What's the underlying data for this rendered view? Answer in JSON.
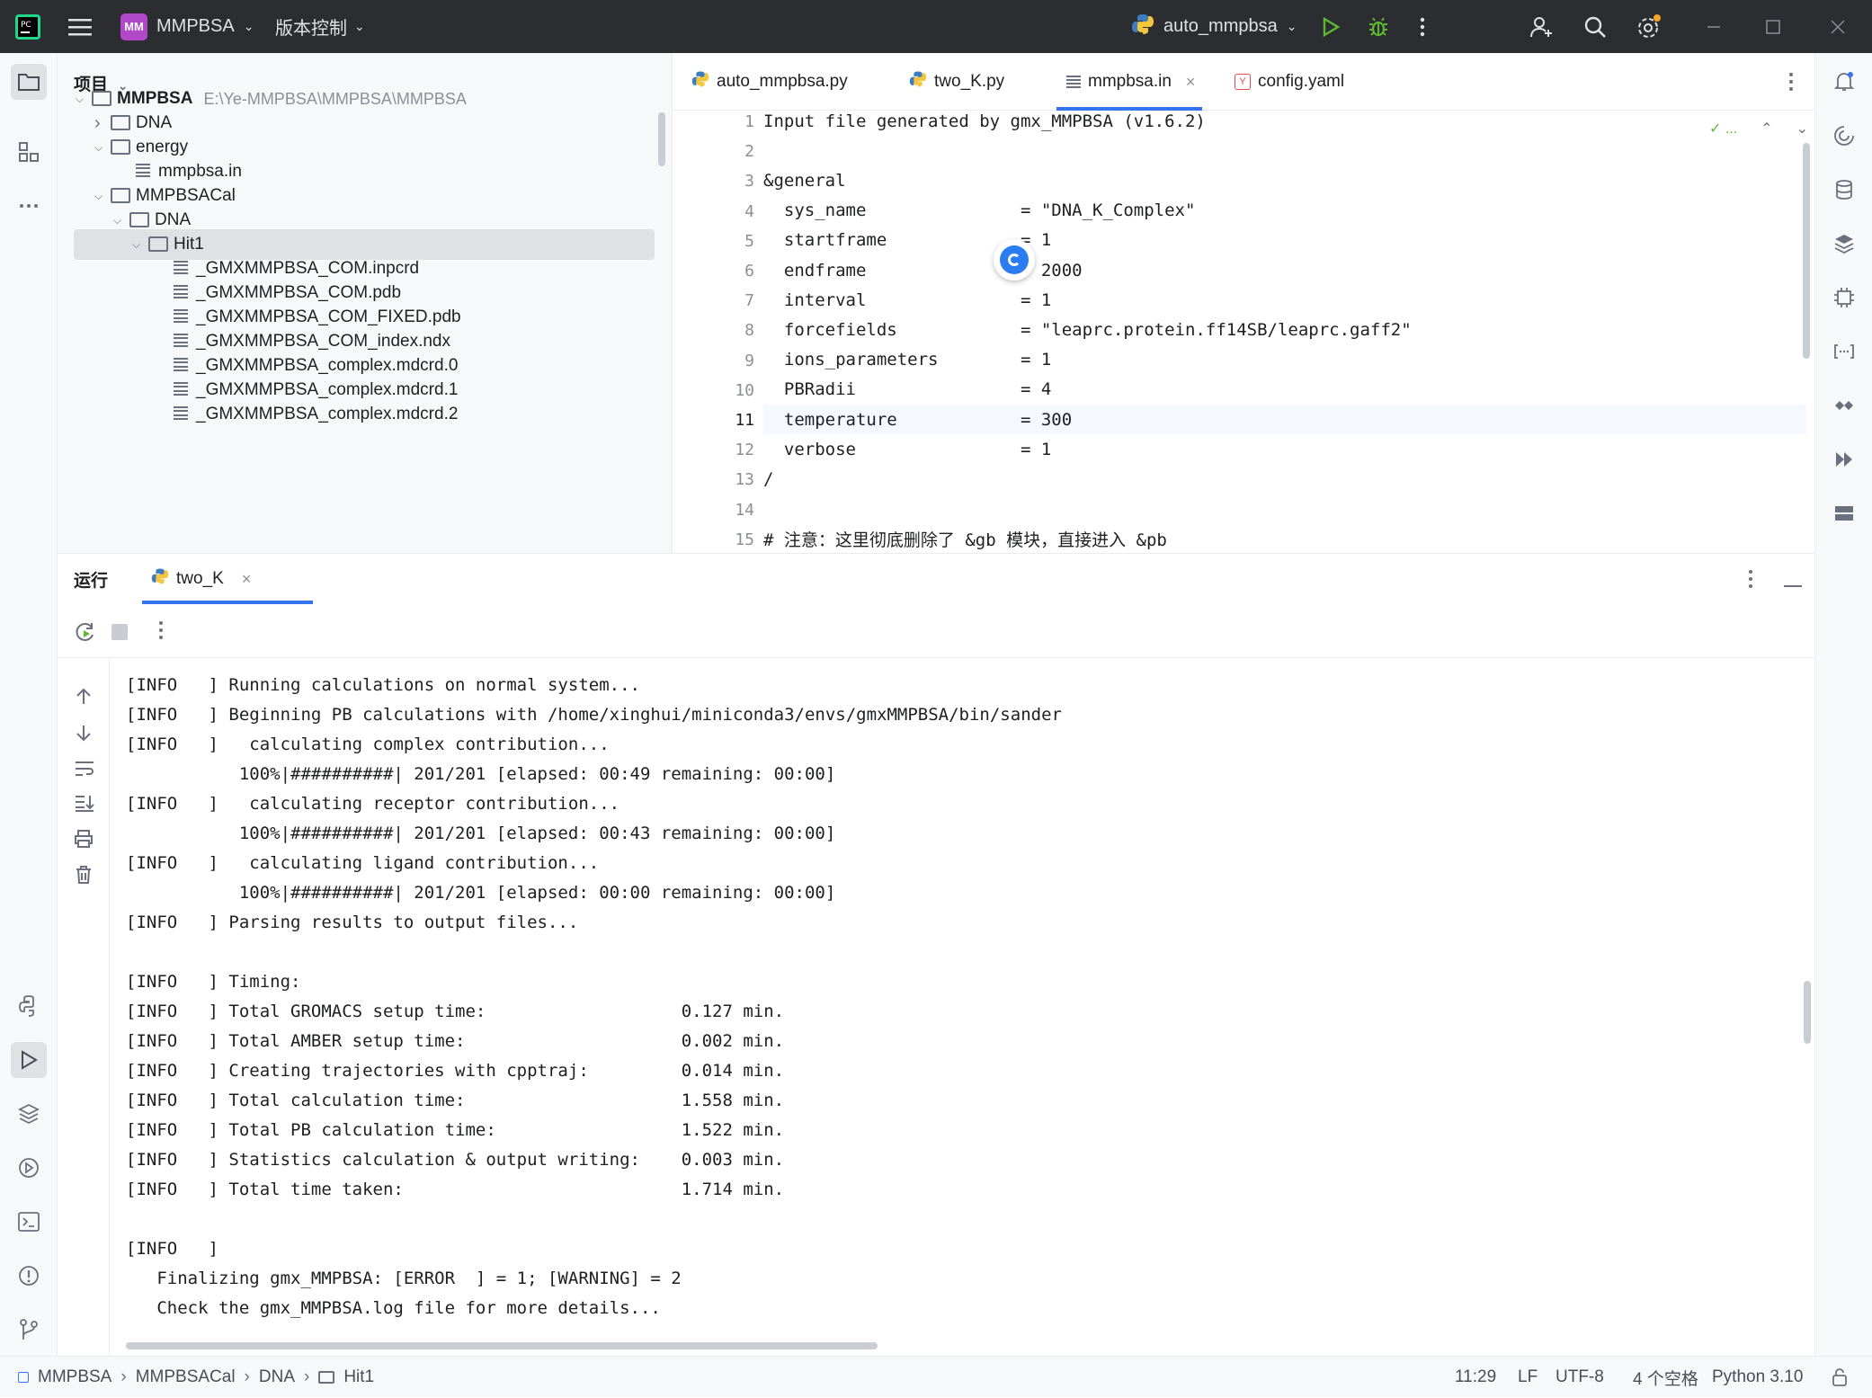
{
  "titlebar": {
    "project_badge": "MM",
    "project_name": "MMPBSA",
    "vcs_label": "版本控制",
    "run_config": "auto_mmpbsa"
  },
  "project_panel": {
    "title": "项目",
    "tree": [
      {
        "label": "MMPBSA",
        "path": "E:\\Ye-MMPBSA\\MMPBSA\\MMPBSA",
        "type": "folder",
        "depth": 0,
        "expanded": true
      },
      {
        "label": "DNA",
        "type": "folder",
        "depth": 1,
        "expanded": false
      },
      {
        "label": "energy",
        "type": "folder",
        "depth": 1,
        "expanded": true
      },
      {
        "label": "mmpbsa.in",
        "type": "file",
        "depth": 2
      },
      {
        "label": "MMPBSACal",
        "type": "folder",
        "depth": 1,
        "expanded": true
      },
      {
        "label": "DNA",
        "type": "folder",
        "depth": 2,
        "expanded": true
      },
      {
        "label": "Hit1",
        "type": "folder",
        "depth": 3,
        "expanded": true,
        "selected": true
      },
      {
        "label": "_GMXMMPBSA_COM.inpcrd",
        "type": "file",
        "depth": 4
      },
      {
        "label": "_GMXMMPBSA_COM.pdb",
        "type": "file",
        "depth": 4
      },
      {
        "label": "_GMXMMPBSA_COM_FIXED.pdb",
        "type": "file",
        "depth": 4
      },
      {
        "label": "_GMXMMPBSA_COM_index.ndx",
        "type": "file",
        "depth": 4
      },
      {
        "label": "_GMXMMPBSA_complex.mdcrd.0",
        "type": "file",
        "depth": 4
      },
      {
        "label": "_GMXMMPBSA_complex.mdcrd.1",
        "type": "file",
        "depth": 4
      },
      {
        "label": "_GMXMMPBSA_complex.mdcrd.2",
        "type": "file",
        "depth": 4
      }
    ]
  },
  "editor": {
    "tabs": [
      {
        "label": "auto_mmpbsa.py",
        "icon": "python-icon"
      },
      {
        "label": "two_K.py",
        "icon": "python-icon"
      },
      {
        "label": "mmpbsa.in",
        "icon": "text-file-icon",
        "active": true
      },
      {
        "label": "config.yaml",
        "icon": "yaml-icon"
      }
    ],
    "inspection": "✓ ...",
    "current_line": 11,
    "lines": [
      {
        "n": "1",
        "text": "Input file generated by gmx_MMPBSA (v1.6.2)"
      },
      {
        "n": "2",
        "text": ""
      },
      {
        "n": "3",
        "text": "&general"
      },
      {
        "n": "4",
        "text": "  sys_name               = \"DNA_K_Complex\""
      },
      {
        "n": "5",
        "text": "  startframe             = 1"
      },
      {
        "n": "6",
        "text": "  endframe               = 2000"
      },
      {
        "n": "7",
        "text": "  interval               = 1"
      },
      {
        "n": "8",
        "text": "  forcefields            = \"leaprc.protein.ff14SB/leaprc.gaff2\""
      },
      {
        "n": "9",
        "text": "  ions_parameters        = 1"
      },
      {
        "n": "10",
        "text": "  PBRadii                = 4"
      },
      {
        "n": "11",
        "text": "  temperature            = 300"
      },
      {
        "n": "12",
        "text": "  verbose                = 1"
      },
      {
        "n": "13",
        "text": "/"
      },
      {
        "n": "14",
        "text": ""
      },
      {
        "n": "15",
        "text": "# 注意：这里彻底删除了 &gb 模块，直接进入 &pb"
      }
    ]
  },
  "run_panel": {
    "title": "运行",
    "tab_label": "two_K",
    "output": [
      "[INFO   ] Running calculations on normal system...",
      "[INFO   ] Beginning PB calculations with /home/xinghui/miniconda3/envs/gmxMMPBSA/bin/sander",
      "[INFO   ]   calculating complex contribution...",
      "           100%|##########| 201/201 [elapsed: 00:49 remaining: 00:00]",
      "[INFO   ]   calculating receptor contribution...",
      "           100%|##########| 201/201 [elapsed: 00:43 remaining: 00:00]",
      "[INFO   ]   calculating ligand contribution...",
      "           100%|##########| 201/201 [elapsed: 00:00 remaining: 00:00]",
      "[INFO   ] Parsing results to output files...",
      "",
      "[INFO   ] Timing:",
      "[INFO   ] Total GROMACS setup time:                   0.127 min.",
      "[INFO   ] Total AMBER setup time:                     0.002 min.",
      "[INFO   ] Creating trajectories with cpptraj:         0.014 min.",
      "[INFO   ] Total calculation time:                     1.558 min.",
      "[INFO   ] Total PB calculation time:                  1.522 min.",
      "[INFO   ] Statistics calculation & output writing:    0.003 min.",
      "[INFO   ] Total time taken:                           1.714 min.",
      "",
      "[INFO   ]",
      "   Finalizing gmx_MMPBSA: [ERROR  ] = 1; [WARNING] = 2",
      "   Check the gmx_MMPBSA.log file for more details..."
    ]
  },
  "statusbar": {
    "breadcrumb": [
      "MMPBSA",
      "MMPBSACal",
      "DNA",
      "Hit1"
    ],
    "position": "11:29",
    "line_sep": "LF",
    "encoding": "UTF-8",
    "indent": "4 个空格",
    "interpreter": "Python 3.10"
  },
  "colors": {
    "accent": "#3574f0",
    "run_green": "#5fb832",
    "debug_green": "#5fb832",
    "titlebar_bg": "#2b2d30",
    "string_color": "#1e1f22"
  }
}
